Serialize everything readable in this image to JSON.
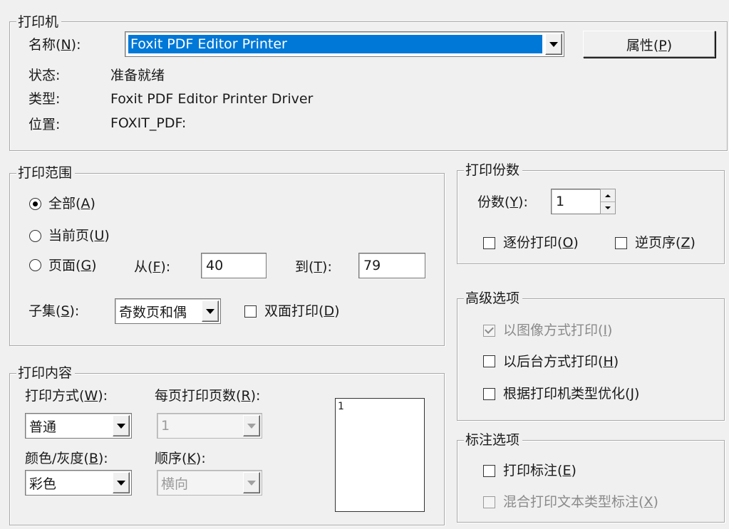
{
  "printer": {
    "group_title": "打印机",
    "name_label": "名称",
    "name_key": "N",
    "selected_printer": "Foxit PDF Editor Printer",
    "properties_label": "属性",
    "properties_key": "P",
    "status_label": "状态:",
    "status_value": "准备就绪",
    "type_label": "类型:",
    "type_value": "Foxit PDF Editor Printer Driver",
    "location_label": "位置:",
    "location_value": "FOXIT_PDF:"
  },
  "print_range": {
    "group_title": "打印范围",
    "all_label": "全部",
    "all_key": "A",
    "current_label": "当前页",
    "current_key": "U",
    "pages_label": "页面",
    "pages_key": "G",
    "from_label": "从",
    "from_key": "F",
    "from_value": "40",
    "to_label": "到",
    "to_key": "T",
    "to_value": "79",
    "subset_label": "子集",
    "subset_key": "S",
    "subset_value": "奇数页和偶",
    "duplex_label": "双面打印",
    "duplex_key": "D",
    "selected": "all"
  },
  "copies": {
    "group_title": "打印份数",
    "count_label": "份数",
    "count_key": "Y",
    "count_value": "1",
    "collate_label": "逐份打印",
    "collate_key": "O",
    "reverse_label": "逆页序",
    "reverse_key": "Z"
  },
  "advanced": {
    "group_title": "高级选项",
    "as_image_label": "以图像方式打印",
    "as_image_key": "I",
    "background_label": "以后台方式打印",
    "background_key": "H",
    "optimize_label": "根据打印机类型优化",
    "optimize_key": "J"
  },
  "annotations": {
    "group_title": "标注选项",
    "print_annot_label": "打印标注",
    "print_annot_key": "E",
    "mixed_label": "混合打印文本类型标注",
    "mixed_key": "X"
  },
  "content": {
    "group_title": "打印内容",
    "mode_label": "打印方式",
    "mode_key": "W",
    "mode_value": "普通",
    "pages_per_sheet_label": "每页打印页数",
    "pages_per_sheet_key": "R",
    "pages_per_sheet_value": "1",
    "color_label": "颜色/灰度",
    "color_key": "B",
    "color_value": "彩色",
    "order_label": "顺序",
    "order_key": "K",
    "order_value": "横向",
    "preview_page_number": "1"
  },
  "colors": {
    "selection_bg": "#0078d7",
    "selection_text": "#ffffff",
    "window_bg": "#f0f0f0"
  }
}
